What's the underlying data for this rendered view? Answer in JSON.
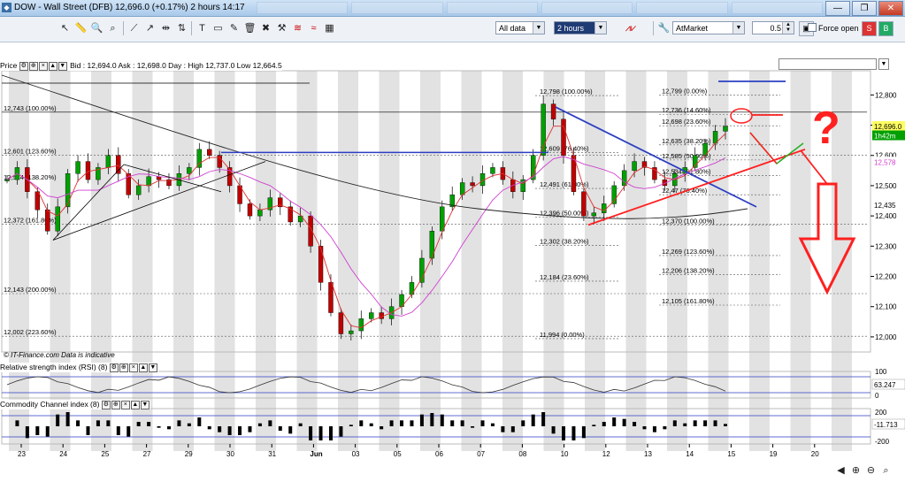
{
  "window": {
    "title": "DOW - Wall Street (DFB)   12,696.0 (+0.17%)   2 hours  14:17",
    "ghost_tabs": [
      "",
      "",
      "",
      "",
      "",
      ""
    ],
    "minimize": "—",
    "maximize": "❐",
    "close": "✕"
  },
  "toolbar": {
    "data_select": "All data",
    "interval_select": "2 hours",
    "order_type": "AtMarket",
    "quantity": "0.5",
    "force_open_label": "Force open"
  },
  "price_pane": {
    "header_label": "Price",
    "quote_text": "Bid : 12,694.0 Ask : 12,698.0  Day : High 12,737.0 Low 12,664.5",
    "watermark": "© IT-Finance.com  Data is indicative",
    "current_price": "12,696.0",
    "countdown": "1h42m",
    "ma_value": "12,578",
    "ma2_value": "12,435"
  },
  "rsi_pane": {
    "header_label": "Relative strength index (RSI) (8)",
    "value": "63.247"
  },
  "cci_pane": {
    "header_label": "Commodity Channel index (8)",
    "value": "-11.713"
  },
  "colors": {
    "candle_up": "#00a000",
    "candle_down": "#c00000",
    "blue_line": "#2b3fc2",
    "red_line": "#ff2020",
    "green_line": "#20b020",
    "ma_red": "#e03030",
    "ma_magenta": "#d040d0"
  },
  "chart_data": {
    "type": "candlestick",
    "ylim": [
      11950,
      12880
    ],
    "y_ticks": [
      "12,800",
      "12,700",
      "12,600",
      "12,500",
      "12,400",
      "12,300",
      "12,200",
      "12,100",
      "12,000"
    ],
    "y_tick_values": [
      12800,
      12700,
      12600,
      12500,
      12400,
      12300,
      12200,
      12100,
      12000
    ],
    "x_ticks": [
      "23",
      "24",
      "25",
      "27",
      "29",
      "30",
      "31",
      "Jun",
      "03",
      "05",
      "06",
      "07",
      "08",
      "10",
      "12",
      "13",
      "14",
      "15",
      "19",
      "20"
    ],
    "rsi_ticks": [
      "100",
      "0"
    ],
    "cci_ticks": [
      "200",
      "0",
      "-200"
    ],
    "fib_left": [
      {
        "label": "12,743 (100.00%)",
        "y": 12743
      },
      {
        "label": "12,601 (123.60%)",
        "y": 12601
      },
      {
        "label": "12,514 (138.20%)",
        "y": 12514
      },
      {
        "label": "12,372 (161.80%)",
        "y": 12372
      },
      {
        "label": "12,143 (200.00%)",
        "y": 12143
      },
      {
        "label": "12,002 (223.60%)",
        "y": 12002
      }
    ],
    "fib_mid": [
      {
        "label": "12,798 (100.00%)",
        "y": 12798
      },
      {
        "label": "12,609 (76.40%)",
        "y": 12609
      },
      {
        "label": "12,491 (61.80%)",
        "y": 12491
      },
      {
        "label": "12,396 (50.00%)",
        "y": 12396
      },
      {
        "label": "12,302 (38.20%)",
        "y": 12302
      },
      {
        "label": "12,184 (23.60%)",
        "y": 12184
      },
      {
        "label": "11,994 (0.00%)",
        "y": 11994
      }
    ],
    "fib_right": [
      {
        "label": "12,799 (0.00%)",
        "y": 12799
      },
      {
        "label": "12,736 (14.60%)",
        "y": 12736
      },
      {
        "label": "12,698 (23.60%)",
        "y": 12698
      },
      {
        "label": "12,635 (38.20%)",
        "y": 12635
      },
      {
        "label": "12,585 (50.00%)",
        "y": 12585
      },
      {
        "label": "12,534 (61.80%)",
        "y": 12534
      },
      {
        "label": "12,47 (76.40%)",
        "y": 12470
      },
      {
        "label": "12,370 (100.00%)",
        "y": 12370
      },
      {
        "label": "12,269 (123.60%)",
        "y": 12269
      },
      {
        "label": "12,206 (138.20%)",
        "y": 12206
      },
      {
        "label": "12,105 (161.80%)",
        "y": 12105
      }
    ],
    "close_series": [
      12520,
      12560,
      12480,
      12420,
      12350,
      12430,
      12540,
      12580,
      12520,
      12560,
      12600,
      12540,
      12470,
      12500,
      12530,
      12520,
      12500,
      12540,
      12560,
      12620,
      12600,
      12560,
      12500,
      12440,
      12400,
      12420,
      12460,
      12430,
      12380,
      12400,
      12300,
      12180,
      12080,
      12010,
      12020,
      12060,
      12080,
      12060,
      12100,
      12140,
      12180,
      12260,
      12350,
      12430,
      12470,
      12510,
      12500,
      12540,
      12560,
      12520,
      12480,
      12520,
      12600,
      12770,
      12720,
      12600,
      12480,
      12400,
      12410,
      12440,
      12500,
      12550,
      12580,
      12560,
      12520,
      12500,
      12540,
      12560,
      12600,
      12640,
      12680,
      12696
    ],
    "annotation": "?"
  }
}
